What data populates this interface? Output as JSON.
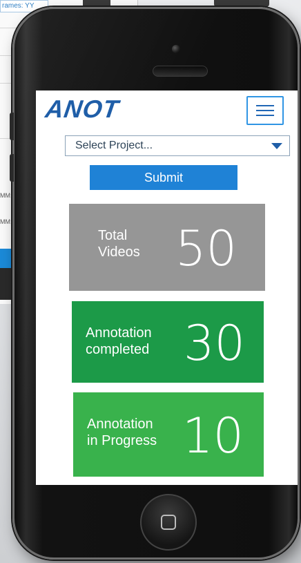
{
  "background": {
    "field_text": "rames: YY",
    "side_texts": [
      "MM;S",
      "MM;"
    ]
  },
  "app": {
    "brand": "ANOT",
    "menu_icon": "hamburger-menu-icon",
    "project_select": {
      "selected": "Select Project...",
      "caret_icon": "caret-down-icon"
    },
    "submit_label": "Submit",
    "stats": [
      {
        "label": "Total\nVideos",
        "value": "50",
        "color": "#969696"
      },
      {
        "label": "Annotation\ncompleted",
        "value": "30",
        "color": "#1c9a48"
      },
      {
        "label": "Annotation\nin Progress",
        "value": "10",
        "color": "#39b24c"
      }
    ]
  },
  "device": {
    "home_icon": "home-square-icon"
  }
}
